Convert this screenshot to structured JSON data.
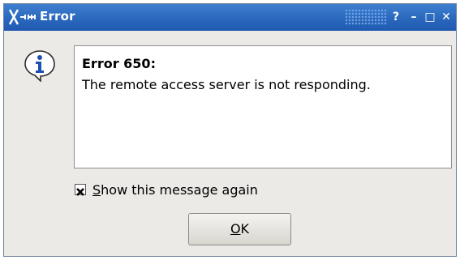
{
  "window": {
    "title": "Error",
    "controls": {
      "help": "?",
      "minimize": "–",
      "maximize": "□",
      "close": "✕"
    }
  },
  "message": {
    "icon": "info-icon",
    "title": "Error 650:",
    "body": "The remote access server is not responding."
  },
  "checkbox": {
    "checked": true,
    "label_mnemonic": "S",
    "label_rest": "how this message again"
  },
  "ok_button": {
    "label_mnemonic": "O",
    "label_rest": "K"
  },
  "colors": {
    "titlebar": "#2d6cc0",
    "window_bg": "#eceae6",
    "info_icon": "#1f4fb0"
  }
}
